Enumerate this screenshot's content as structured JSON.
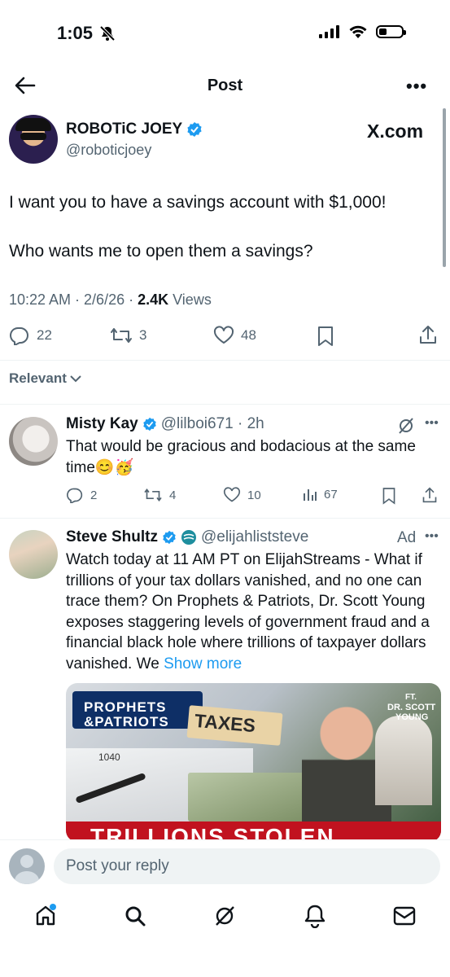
{
  "status_bar": {
    "time": "1:05"
  },
  "header": {
    "title": "Post"
  },
  "post": {
    "author_name": "ROBOTiC JOEY",
    "author_handle": "@roboticjoey",
    "brand": "X.com",
    "text_line1": "I want you to have a savings account with $1,000!",
    "text_line2": "Who wants me to open them a savings?",
    "time_date": "10:22 AM · 2/6/26 · ",
    "views_count": "2.4K",
    "views_label": " Views",
    "replies": "22",
    "reposts": "3",
    "likes": "48"
  },
  "sort": {
    "label": "Relevant"
  },
  "reply1": {
    "name": "Misty Kay",
    "handle": "@lilboi671 · 2h",
    "text": "That would be gracious and bodacious at the same time😊🥳",
    "replies": "2",
    "reposts": "4",
    "likes": "10",
    "views": "67"
  },
  "reply2": {
    "name": "Steve Shultz",
    "handle": "@elijahliststeve",
    "ad_label": "Ad",
    "text": "Watch today at 11 AM PT on ElijahStreams - What if trillions of your tax dollars vanished, and no one can trace them?  On Prophets & Patriots, Dr. Scott Young exposes staggering levels of government fraud and a financial black hole where trillions of taxpayer dollars vanished. We ",
    "show_more": "Show more",
    "image_title1": "PROPHETS",
    "image_title2": "&PATRIOTS",
    "image_taxes": "TAXES",
    "image_ft": "FT.",
    "image_guest1": "DR. SCOTT",
    "image_guest2": "YOUNG",
    "image_form": "1040",
    "image_banner": "TRILLIONS STOLEN"
  },
  "compose": {
    "placeholder": "Post your reply"
  },
  "colors": {
    "accent": "#1d9bf0",
    "text": "#0f1419",
    "muted": "#536471"
  }
}
